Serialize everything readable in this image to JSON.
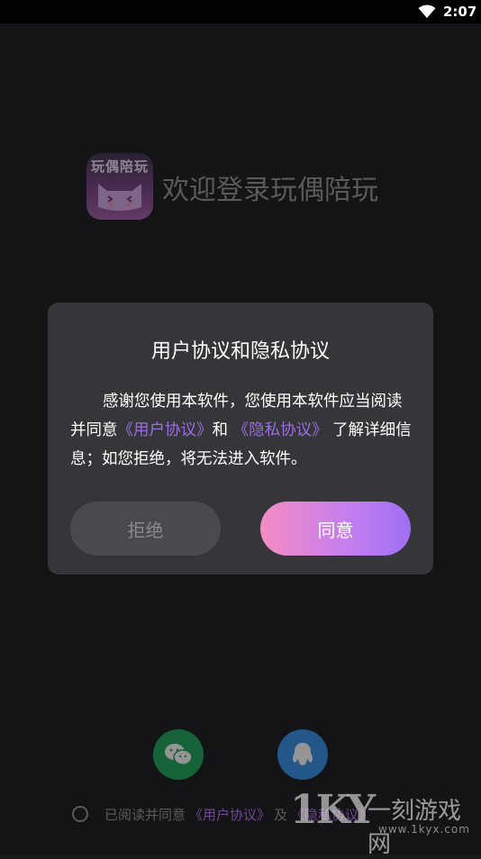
{
  "status_bar": {
    "time": "2:07",
    "wifi_icon": "wifi-icon"
  },
  "app": {
    "logo_text": "玩偶陪玩",
    "welcome": "欢迎登录玩偶陪玩"
  },
  "dialog": {
    "title": "用户协议和隐私协议",
    "body_part1": "感谢您使用本软件，您使用本软件应当阅读并同意",
    "user_agreement_link": "《用户协议》",
    "and": "和",
    "privacy_link": "《隐私协议》",
    "body_part2": "了解详细信息；如您拒绝，将无法进入软件。",
    "reject_label": "拒绝",
    "agree_label": "同意"
  },
  "social_login": {
    "wechat_icon": "wechat-icon",
    "qq_icon": "qq-icon"
  },
  "agreement_row": {
    "prefix": "已阅读并同意",
    "user_agreement_link": "《用户协议》",
    "and": "及",
    "privacy_link": "《隐私协议》"
  },
  "watermark": {
    "brand": "1KY",
    "cn_text": "一刻游戏网",
    "url": "www.1kyx.com"
  },
  "colors": {
    "accent_link": "#9a6fe0",
    "agree_gradient_start": "#f58cc3",
    "agree_gradient_end": "#9f6ff2",
    "dialog_bg": "#36363a"
  }
}
